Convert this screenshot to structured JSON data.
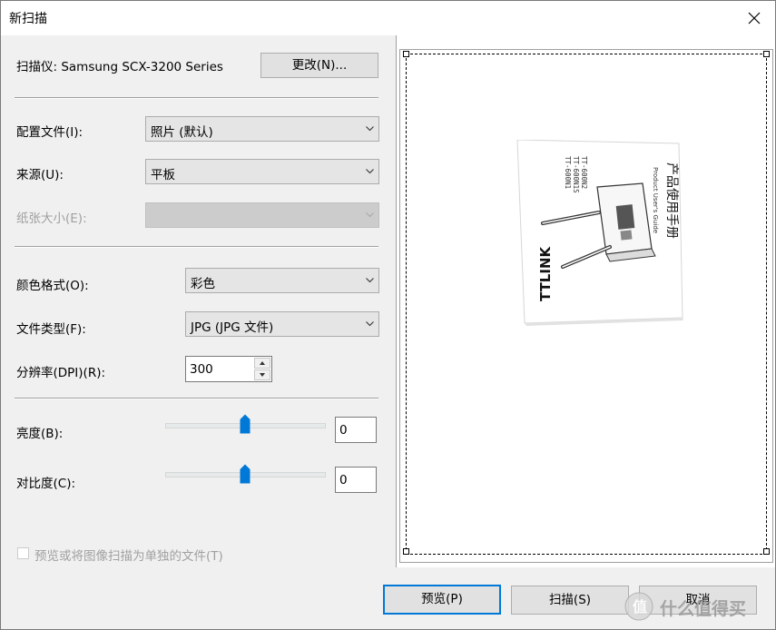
{
  "window": {
    "title": "新扫描",
    "close_icon": "close-icon"
  },
  "scanner": {
    "label": "扫描仪: Samsung SCX-3200 Series",
    "change_button": "更改(N)..."
  },
  "profile": {
    "label": "配置文件(I):",
    "value": "照片 (默认)"
  },
  "source": {
    "label": "来源(U):",
    "value": "平板"
  },
  "paper_size": {
    "label": "纸张大小(E):",
    "value": ""
  },
  "color_format": {
    "label": "颜色格式(O):",
    "value": "彩色"
  },
  "file_type": {
    "label": "文件类型(F):",
    "value": "JPG (JPG 文件)"
  },
  "resolution": {
    "label": "分辨率(DPI)(R):",
    "value": "300"
  },
  "brightness": {
    "label": "亮度(B):",
    "value": "0",
    "level": 0.5
  },
  "contrast": {
    "label": "对比度(C):",
    "value": "0",
    "level": 0.5
  },
  "separate_files": {
    "label": "预览或将图像扫描为单独的文件(T)",
    "checked": false
  },
  "buttons": {
    "preview": "预览(P)",
    "scan": "扫描(S)",
    "cancel": "取消"
  },
  "preview_document": {
    "brand": "TTLINK",
    "models": [
      "TT-600N1",
      "TT-600N1S",
      "TT-600N2"
    ],
    "title_cn": "产品使用手册",
    "title_en": "Product User's Guide"
  },
  "watermark": {
    "text": "什么值得买"
  },
  "colors": {
    "accent": "#0078d7",
    "dialog_bg": "#f0f0f0"
  }
}
